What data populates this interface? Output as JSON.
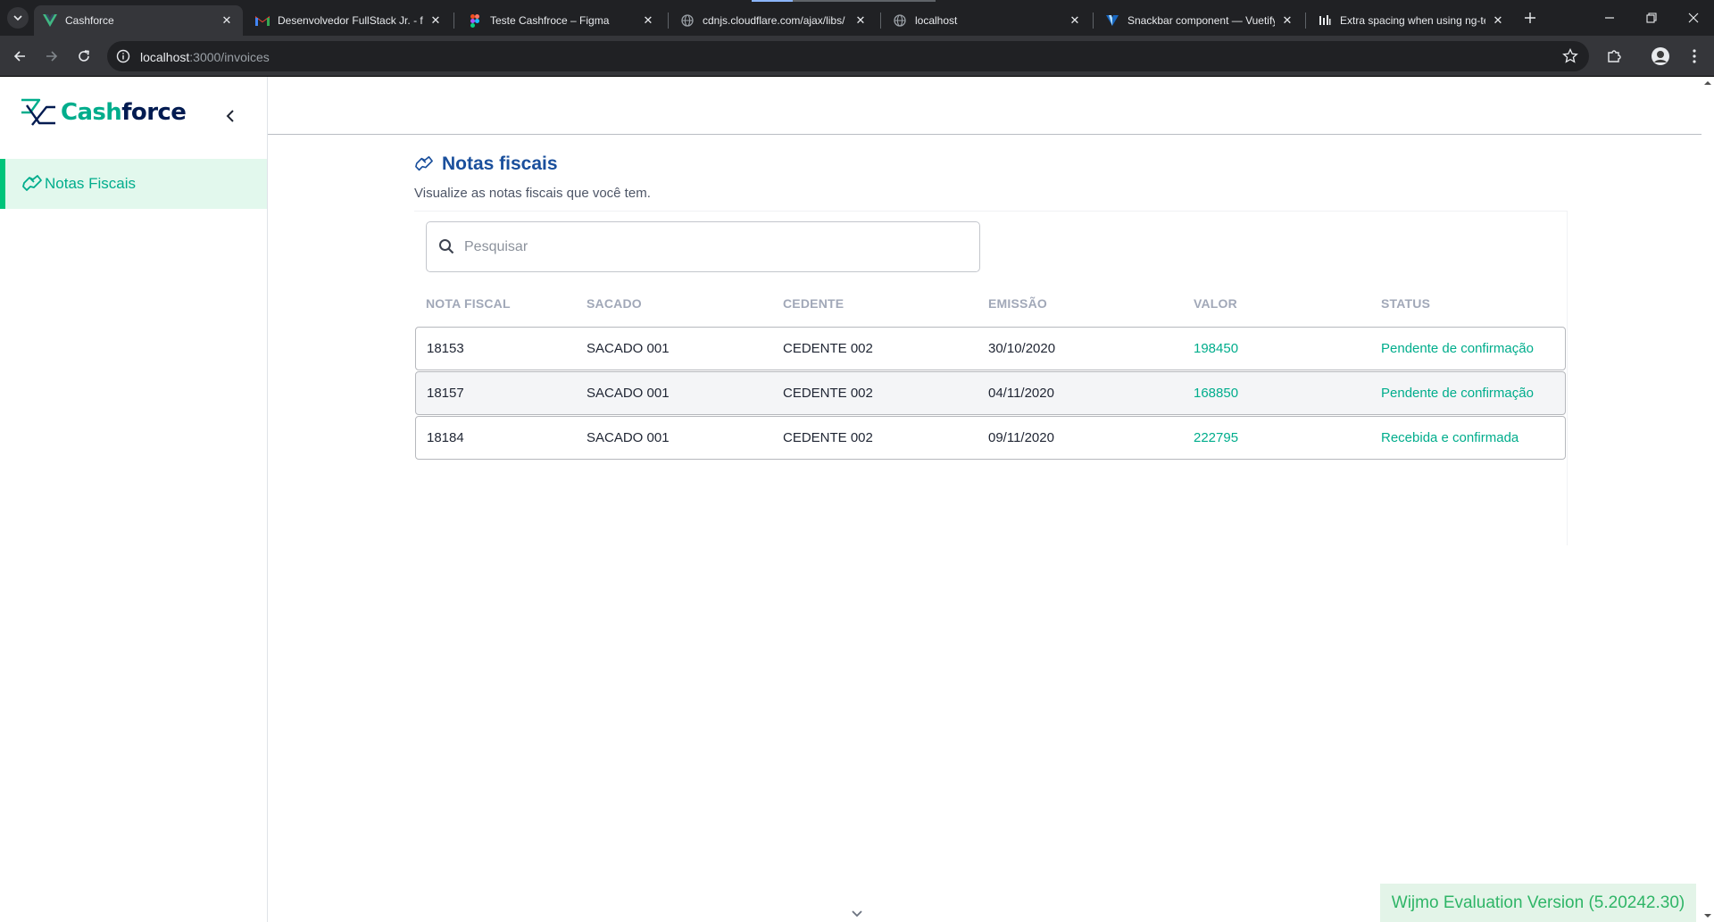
{
  "browser": {
    "tabs": [
      {
        "title": "Cashforce",
        "icon": "vue-icon",
        "active": true
      },
      {
        "title": "Desenvolvedor FullStack Jr. - fu",
        "icon": "gmail-icon",
        "active": false
      },
      {
        "title": "Teste Cashfroce – Figma",
        "icon": "figma-icon",
        "active": false
      },
      {
        "title": "cdnjs.cloudflare.com/ajax/libs/",
        "icon": "globe-icon",
        "active": false
      },
      {
        "title": "localhost",
        "icon": "globe-icon",
        "active": false
      },
      {
        "title": "Snackbar component — Vuetify",
        "icon": "vuetify-icon",
        "active": false
      },
      {
        "title": "Extra spacing when using ng-te",
        "icon": "github-icon",
        "active": false
      }
    ],
    "url": {
      "host": "localhost",
      "path": ":3000/invoices"
    }
  },
  "sidebar": {
    "logo": {
      "part1": "Cash",
      "part2": "force"
    },
    "items": [
      {
        "label": "Notas Fiscais",
        "active": true
      }
    ]
  },
  "main": {
    "title": "Notas fiscais",
    "subtitle": "Visualize as notas fiscais que você tem.",
    "search_placeholder": "Pesquisar",
    "table": {
      "headers": [
        "NOTA FISCAL",
        "SACADO",
        "CEDENTE",
        "EMISSÃO",
        "VALOR",
        "STATUS"
      ],
      "rows": [
        {
          "nota": "18153",
          "sacado": "SACADO 001",
          "cedente": "CEDENTE 002",
          "emissao": "30/10/2020",
          "valor": "198450",
          "status": "Pendente de confirmação"
        },
        {
          "nota": "18157",
          "sacado": "SACADO 001",
          "cedente": "CEDENTE 002",
          "emissao": "04/11/2020",
          "valor": "168850",
          "status": "Pendente de confirmação"
        },
        {
          "nota": "18184",
          "sacado": "SACADO 001",
          "cedente": "CEDENTE 002",
          "emissao": "09/11/2020",
          "valor": "222795",
          "status": "Recebida e confirmada"
        }
      ]
    }
  },
  "wijmo_banner": "Wijmo Evaluation Version (5.20242.30)",
  "colors": {
    "brand_green": "#00ad8c",
    "brand_navy": "#021b51",
    "title_blue": "#1a4f9c",
    "active_bg": "#e2f8ed"
  }
}
